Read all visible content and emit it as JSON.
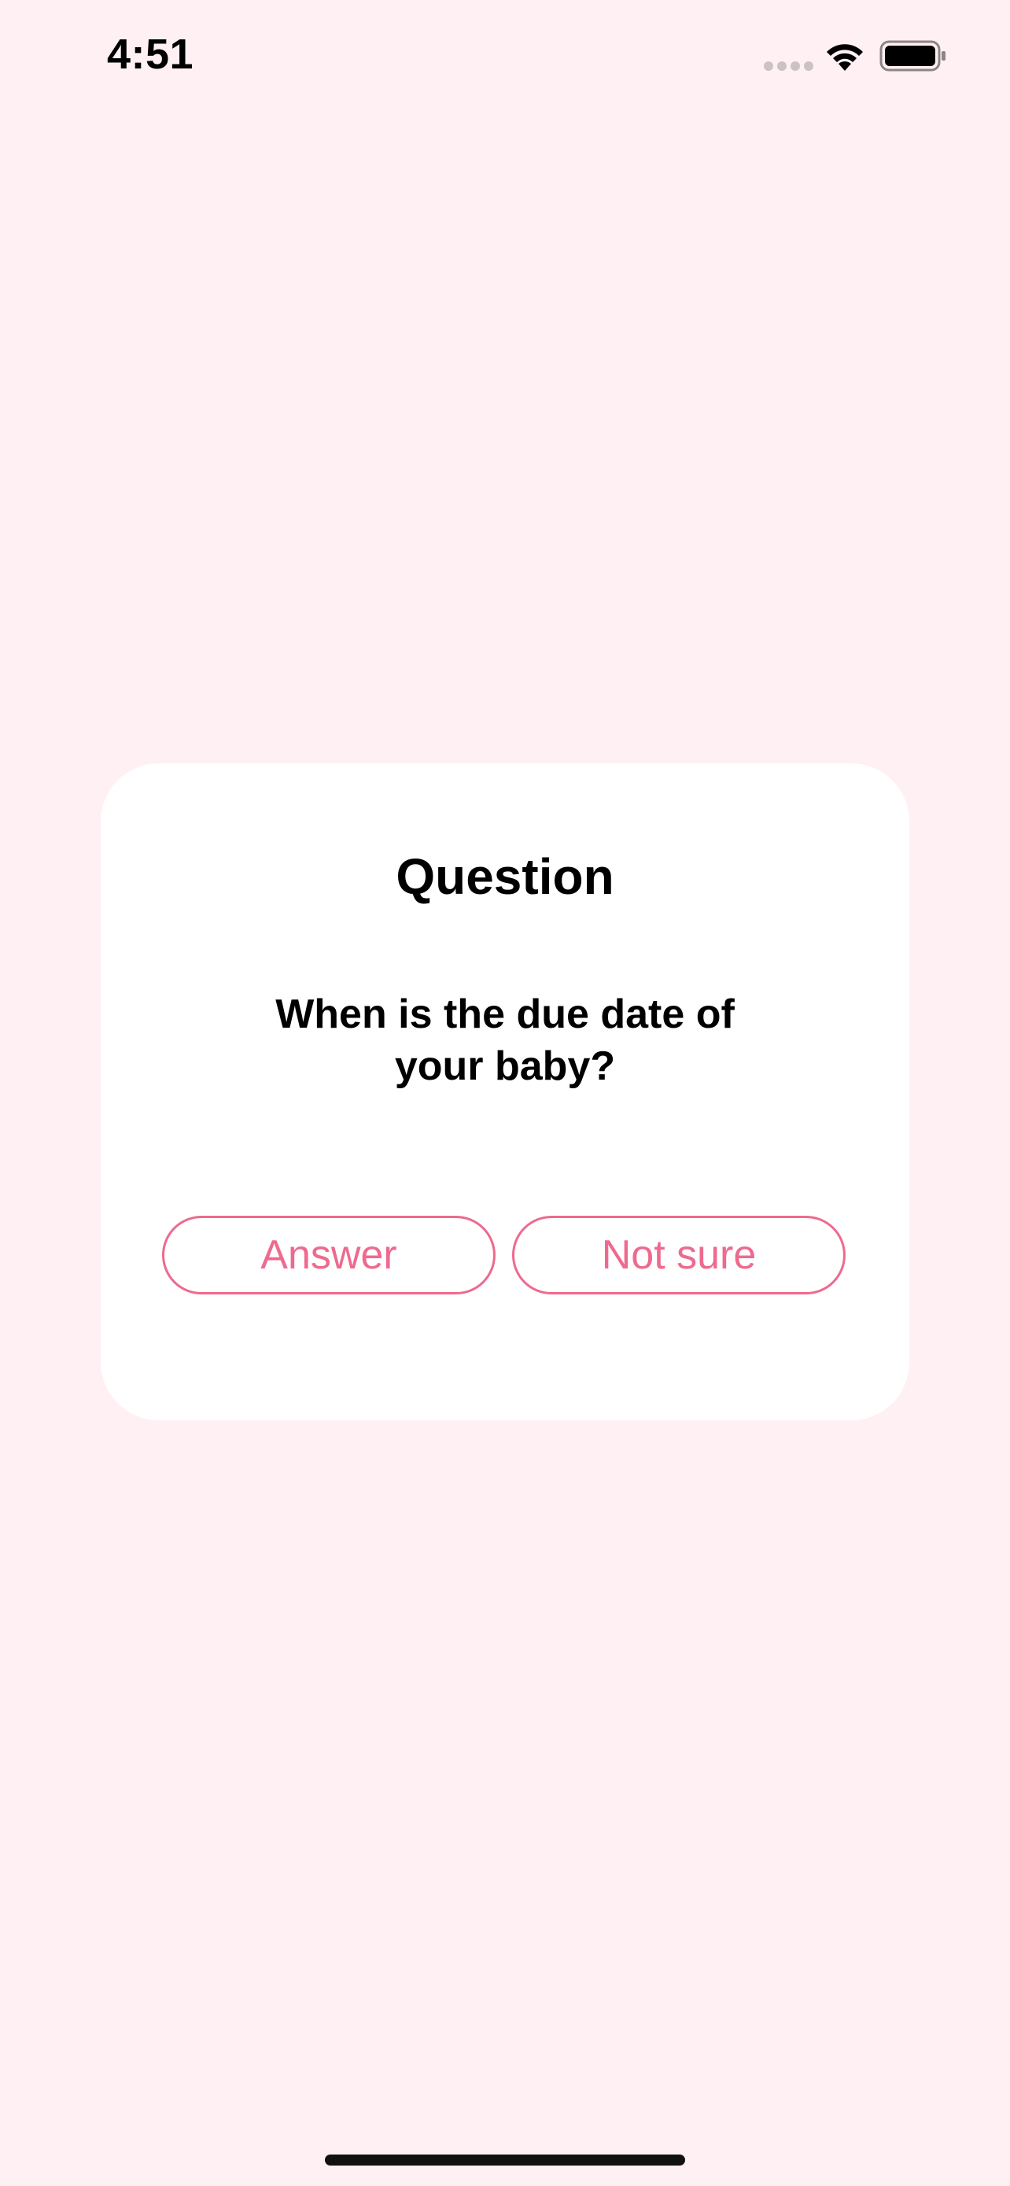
{
  "status_bar": {
    "time": "4:51",
    "icons": [
      "signal-dots-icon",
      "wifi-icon",
      "battery-icon"
    ]
  },
  "dialog": {
    "title": "Question",
    "question": "When is the due date of your baby?",
    "buttons": {
      "answer_label": "Answer",
      "not_sure_label": "Not sure"
    }
  },
  "colors": {
    "background": "#FFF0F3",
    "card": "#FFFFFF",
    "accent": "#EE6A8E",
    "text": "#000000"
  }
}
